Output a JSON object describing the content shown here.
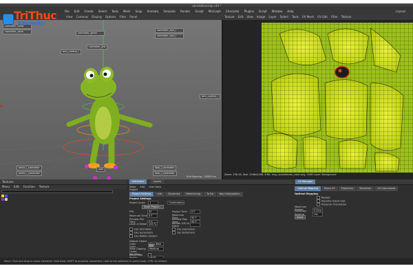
{
  "window": {
    "title": "cainstalloneslip.c4d *"
  },
  "logo": {
    "line1": "TriThuc",
    "line2": "Eduwebs"
  },
  "menubar": {
    "items": [
      "File",
      "Edit",
      "Create",
      "Select",
      "Tools",
      "Mesh",
      "Snap",
      "Animate",
      "Simulate",
      "Render",
      "Sculpt",
      "MoGraph",
      "Character",
      "Plugins",
      "Script",
      "Window",
      "Help"
    ],
    "layout_label": "Layout:"
  },
  "viewport": {
    "toolbar": [
      "View",
      "Cameras",
      "Display",
      "Options",
      "Filter",
      "Panel"
    ],
    "status": "Grid Spacing : 10000 cm",
    "callouts_top": [
      "controller_head",
      "controller_neck",
      "controller_spine",
      "controller_eye_l",
      "controller_eye_r",
      "controller_jaw"
    ],
    "callouts_side": [
      "arm_control_l",
      "arm_control_r"
    ],
    "callouts_bottom": [
      "ankle_l_controller",
      "ankle_r_controller",
      "foot_l_controller",
      "foot_r_controller",
      "root"
    ]
  },
  "uvpanel": {
    "toolbar": [
      "Texture",
      "Edit",
      "View",
      "Image",
      "Layer",
      "Select",
      "Tools",
      "UV Mesh",
      "UV Edit",
      "Filter",
      "Texture"
    ],
    "status": "Zoom: 196.16, Size: 2048x2048, 8 Bit, frog_uvsolidmesh_color.png, 2048 Layer: Background"
  },
  "objects": {
    "title": "Textures",
    "menu": [
      "Menu",
      "Edit",
      "Function",
      "Texture"
    ]
  },
  "attributes": {
    "head": [
      "Attributes",
      "Layers"
    ],
    "menu": [
      "Mode",
      "Edit",
      "User Data"
    ],
    "object_label": "Project",
    "tabs": [
      "Project Settings",
      "Info",
      "Dynamics",
      "Referencing",
      "To Do",
      "Key Interpolation"
    ],
    "section_title": "Project Settings",
    "project_scale_label": "Project Scale",
    "project_scale_value": "1",
    "project_scale_unit": "Centimeters",
    "scale_button": "Scale Project...",
    "fields_left": [
      {
        "label": "FPS",
        "value": "30"
      },
      {
        "label": "Minimum Time",
        "value": "0 F"
      },
      {
        "label": "Preview Min Time",
        "value": "0 F"
      },
      {
        "label": "Level of Detail",
        "value": "100 %"
      }
    ],
    "fields_right": [
      {
        "label": "Project Time",
        "value": "0 F"
      },
      {
        "label": "Maximum Time",
        "value": "90 F"
      },
      {
        "label": "Preview Max Time",
        "value": "90 F"
      },
      {
        "label": "Render LOD in Editor",
        "value": ""
      }
    ],
    "checks_left": [
      "Use Animation",
      "Use Generators",
      "Use Motion System"
    ],
    "checks_right": [
      "Use Expression",
      "Use Deformers"
    ],
    "object_color_label": "Default Object Color",
    "object_color_value": "Gray-Blue",
    "color_label": "Color",
    "view_clipping_label": "View Clipping",
    "view_clipping_value": "Medium",
    "linear_workflow_label": "Linear Workflow",
    "input_color_label": "Input Color Profile",
    "input_color_value": "sRGB"
  },
  "right_panel": {
    "title": "UV Manager",
    "tabs": [
      "Optimal Mapping",
      "Relax UV",
      "Projection",
      "Transform",
      "UV Commands"
    ],
    "section": "Optimal Mapping",
    "options": [
      "Realign",
      "Equalize Island Size",
      "Preserve Orientation"
    ],
    "fields": [
      {
        "label": "Maximum Stretch",
        "value": "100"
      },
      {
        "label": "Distortion",
        "value": "0.01%"
      },
      {
        "label": "Spacing",
        "value": "1%"
      }
    ],
    "apply_button": "Apply"
  },
  "statusbar": {
    "text": "Move: Click and drag to move elements. Hold down SHIFT to quantize movement / add to the selection in point mode, CTRL to remove."
  },
  "colors": {
    "accent": "#5f7fa6",
    "uv_yellow": "#d2e61b",
    "frog_green": "#7fae1e",
    "logo_red": "#f04a19",
    "logo_blue": "#2f6fd6"
  }
}
